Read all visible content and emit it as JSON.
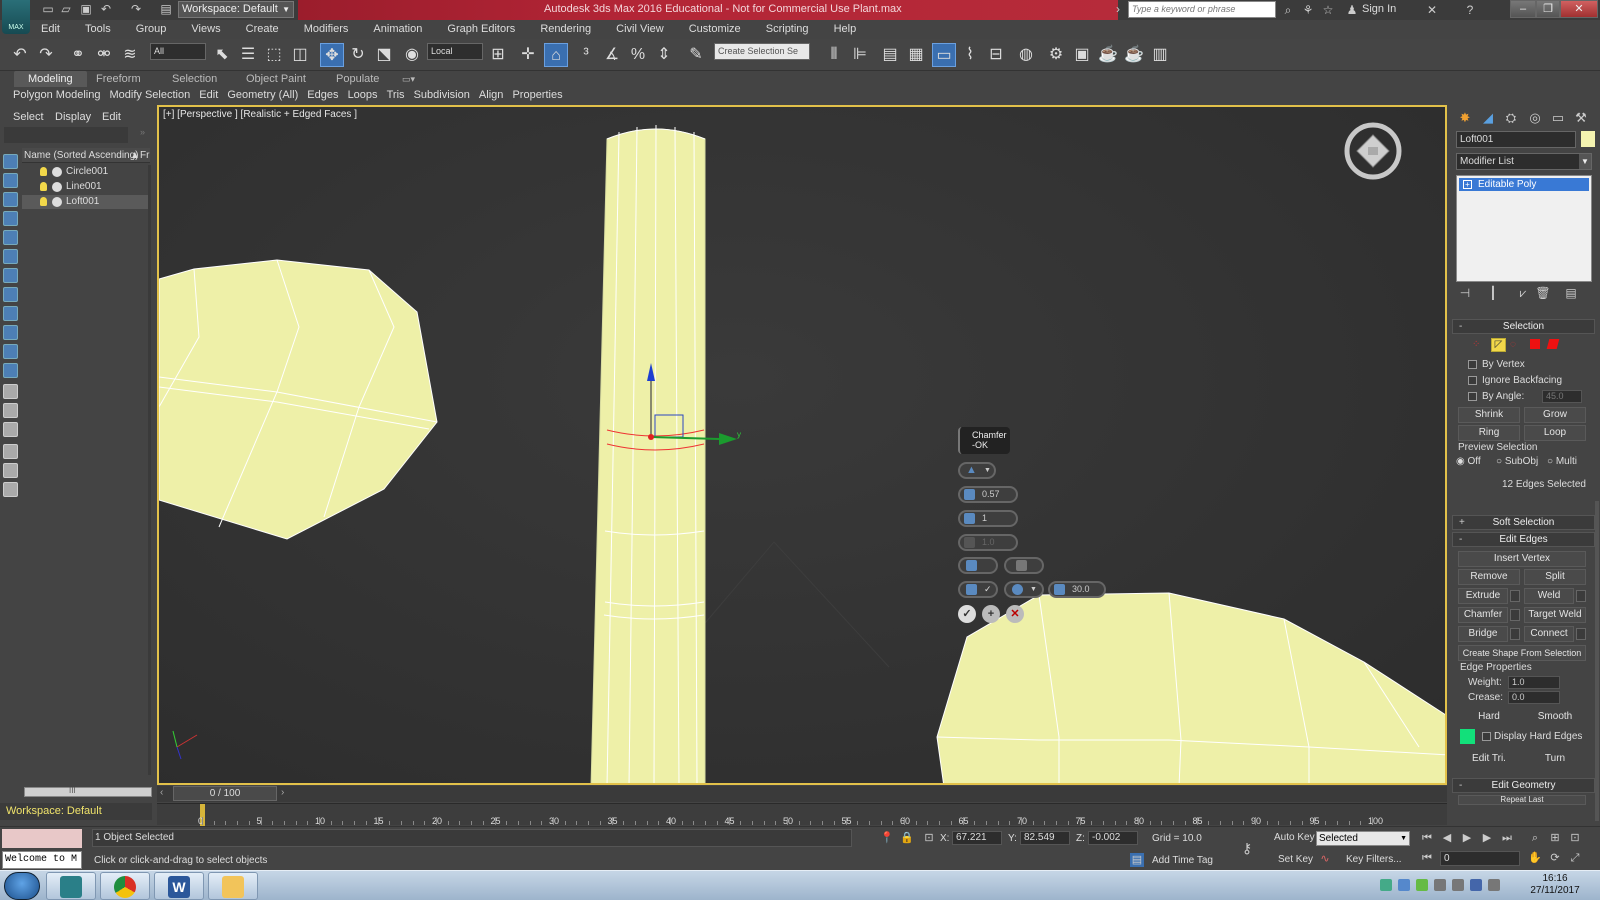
{
  "window": {
    "title": "Autodesk 3ds Max 2016 Educational - Not for Commercial Use    Plant.max",
    "workspace": "Workspace: Default",
    "search_placeholder": "Type a keyword or phrase",
    "sign_in": "Sign In",
    "logo_text": "MAX"
  },
  "menu": [
    "Edit",
    "Tools",
    "Group",
    "Views",
    "Create",
    "Modifiers",
    "Animation",
    "Graph Editors",
    "Rendering",
    "Civil View",
    "Customize",
    "Scripting",
    "Help"
  ],
  "toolbar": {
    "selection_filter": "All",
    "ref_coord": "Local",
    "named_selection_placeholder": "Create Selection Se"
  },
  "ribbon": {
    "tabs": [
      "Modeling",
      "Freeform",
      "Selection",
      "Object Paint",
      "Populate"
    ],
    "active_tab": "Modeling",
    "panels": [
      "Polygon Modeling",
      "Modify Selection",
      "Edit",
      "Geometry (All)",
      "Edges",
      "Loops",
      "Tris",
      "Subdivision",
      "Align",
      "Properties"
    ]
  },
  "explorer": {
    "tabs": [
      "Select",
      "Display",
      "Edit"
    ],
    "column_header": "Name (Sorted Ascending)",
    "column_header_2": "Fr",
    "items": [
      {
        "name": "Circle001",
        "selected": false
      },
      {
        "name": "Line001",
        "selected": false
      },
      {
        "name": "Loft001",
        "selected": true
      }
    ],
    "scroll_label": "III",
    "workspace_label": "Workspace: Default"
  },
  "viewport": {
    "label": "[+] [Perspective ] [Realistic + Edged Faces ]",
    "caddy": {
      "title": "Chamfer",
      "subtitle": "-OK",
      "amount": "0.57",
      "segments": "1",
      "tension": "1.0",
      "smooth_threshold": "30.0"
    },
    "colors": {
      "mesh": "#eef0a8",
      "mesh_edge": "#ffffff",
      "border": "#e2c14a"
    }
  },
  "command_panel": {
    "object_name": "Loft001",
    "object_color": "#f4f3b0",
    "modifier_list": "Modifier List",
    "stack_item": "Editable Poly",
    "selection": {
      "title": "Selection",
      "by_vertex": "By Vertex",
      "ignore_backfacing": "Ignore Backfacing",
      "by_angle": "By Angle:",
      "by_angle_value": "45.0",
      "shrink": "Shrink",
      "grow": "Grow",
      "ring": "Ring",
      "loop": "Loop",
      "preview_selection": "Preview Selection",
      "preview_options": [
        "Off",
        "SubObj",
        "Multi"
      ],
      "status": "12 Edges Selected"
    },
    "soft_selection": "Soft Selection",
    "edit_edges": {
      "title": "Edit Edges",
      "insert_vertex": "Insert Vertex",
      "remove": "Remove",
      "split": "Split",
      "extrude": "Extrude",
      "weld": "Weld",
      "chamfer": "Chamfer",
      "target_weld": "Target Weld",
      "bridge": "Bridge",
      "connect": "Connect",
      "create_shape": "Create Shape From Selection",
      "edge_properties": "Edge Properties",
      "weight_label": "Weight:",
      "weight_value": "1.0",
      "crease_label": "Crease:",
      "crease_value": "0.0",
      "hard": "Hard",
      "smooth": "Smooth",
      "display_hard_edges": "Display Hard Edges",
      "edit_tri": "Edit Tri.",
      "turn": "Turn"
    },
    "edit_geometry": "Edit Geometry",
    "repeat_last": "Repeat Last"
  },
  "timeline": {
    "frame_display": "0 / 100",
    "ticks": [
      "0",
      "5",
      "10",
      "15",
      "20",
      "25",
      "30",
      "35",
      "40",
      "45",
      "50",
      "55",
      "60",
      "65",
      "70",
      "75",
      "80",
      "85",
      "90",
      "95",
      "100"
    ]
  },
  "status": {
    "objects_selected": "1 Object Selected",
    "prompt": "Click or click-and-drag to select objects",
    "maxscript": "Welcome to M",
    "x_label": "X:",
    "x": "67.221",
    "y_label": "Y:",
    "y": "82.549",
    "z_label": "Z:",
    "z": "-0.002",
    "grid": "Grid = 10.0",
    "add_time_tag": "Add Time Tag",
    "auto_key": "Auto Key",
    "set_key": "Set Key",
    "key_mode": "Selected",
    "key_filters": "Key Filters...",
    "current_frame": "0"
  },
  "taskbar": {
    "time": "16:16",
    "date": "27/11/2017"
  }
}
